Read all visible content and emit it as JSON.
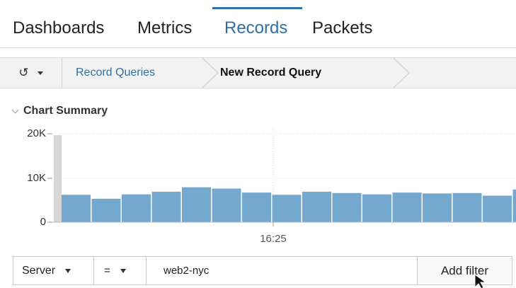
{
  "nav": {
    "tabs": [
      {
        "label": "Dashboards",
        "active": false
      },
      {
        "label": "Metrics",
        "active": false
      },
      {
        "label": "Records",
        "active": true
      },
      {
        "label": "Packets",
        "active": false
      }
    ]
  },
  "breadcrumb": {
    "history_icon": "history-icon",
    "items": [
      {
        "label": "Record Queries",
        "link": true
      },
      {
        "label": "New Record Query",
        "link": false
      }
    ]
  },
  "section": {
    "title": "Chart Summary",
    "expanded": true
  },
  "chart_data": {
    "type": "bar",
    "y_ticks": [
      "20K",
      "10K",
      "0"
    ],
    "ylim": [
      0,
      20000
    ],
    "x_tick_label": "16:25",
    "bar_color": "#74a8cf",
    "values": [
      6200,
      5300,
      6300,
      6900,
      7900,
      7600,
      6700,
      6200,
      6900,
      6600,
      6300,
      6700,
      6500,
      6600,
      6000,
      7400
    ]
  },
  "filter": {
    "field": "Server",
    "operator": "=",
    "value": "web2-nyc",
    "clear_icon": "clear-icon",
    "add_label": "Add filter"
  },
  "colors": {
    "accent": "#2e6fa7",
    "bar": "#74a8cf",
    "cursor_highlight": "#a8a8a8"
  }
}
